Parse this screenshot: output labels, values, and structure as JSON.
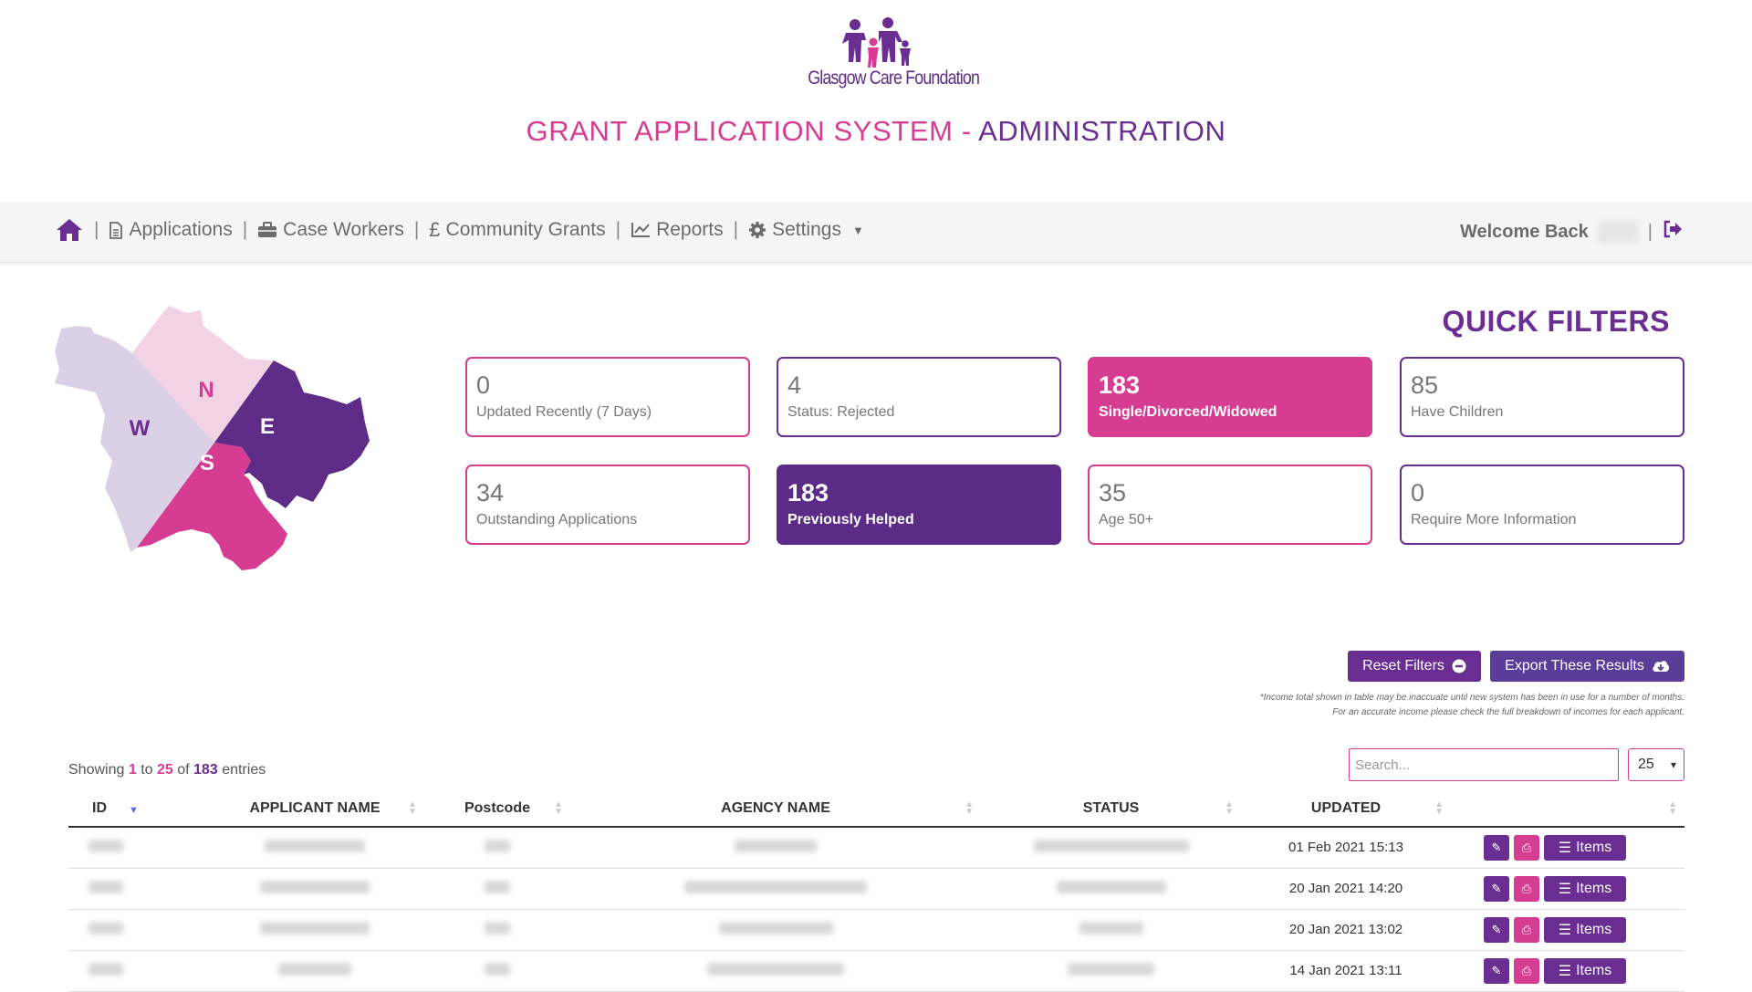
{
  "header": {
    "org_name": "Glasgow Care Foundation",
    "title_part1": "GRANT APPLICATION SYSTEM - ",
    "title_part2": "ADMINISTRATION"
  },
  "nav": {
    "home_icon": "home-icon",
    "items": [
      {
        "label": "Applications",
        "icon": "document-icon"
      },
      {
        "label": "Case Workers",
        "icon": "briefcase-icon"
      },
      {
        "label": "Community Grants",
        "icon": "pound-icon"
      },
      {
        "label": "Reports",
        "icon": "chart-icon"
      },
      {
        "label": "Settings",
        "icon": "gear-icon"
      }
    ],
    "welcome": "Welcome Back",
    "logout_icon": "sign-out-icon"
  },
  "map": {
    "regions": [
      "N",
      "W",
      "E",
      "S"
    ]
  },
  "quick_filters": {
    "title": "QUICK FILTERS",
    "cards": [
      {
        "num": "0",
        "label": "Updated Recently (7 Days)"
      },
      {
        "num": "4",
        "label": "Status: Rejected"
      },
      {
        "num": "183",
        "label": "Single/Divorced/Widowed"
      },
      {
        "num": "85",
        "label": "Have Children"
      },
      {
        "num": "34",
        "label": "Outstanding Applications"
      },
      {
        "num": "183",
        "label": "Previously Helped"
      },
      {
        "num": "35",
        "label": "Age 50+"
      },
      {
        "num": "0",
        "label": "Require More Information"
      }
    ]
  },
  "actions": {
    "reset_label": "Reset Filters",
    "export_label": "Export These Results",
    "note_line1": "*Income total shown in table may be inaccuate until new system has been in use for a number of months.",
    "note_line2": "For an accurate income please check the full breakdown of incomes for each applicant."
  },
  "table_info": {
    "showing": "Showing",
    "from": "1",
    "to_word": "to",
    "to": "25",
    "of_word": "of",
    "total": "183",
    "entries": "entries",
    "search_placeholder": "Search...",
    "page_size": "25"
  },
  "table": {
    "columns": [
      "ID",
      "APPLICANT NAME",
      "Postcode",
      "AGENCY NAME",
      "STATUS",
      "UPDATED",
      ""
    ],
    "rows": [
      {
        "updated": "01 Feb 2021 15:13",
        "items_label": "Items"
      },
      {
        "updated": "20 Jan 2021 14:20",
        "items_label": "Items"
      },
      {
        "updated": "20 Jan 2021 13:02",
        "items_label": "Items"
      },
      {
        "updated": "14 Jan 2021 13:11",
        "items_label": "Items"
      }
    ]
  },
  "colors": {
    "pink": "#d63d92",
    "purple": "#6a2d91",
    "light_lavender": "#dcd0e6",
    "light_pink": "#f2d3e6"
  }
}
